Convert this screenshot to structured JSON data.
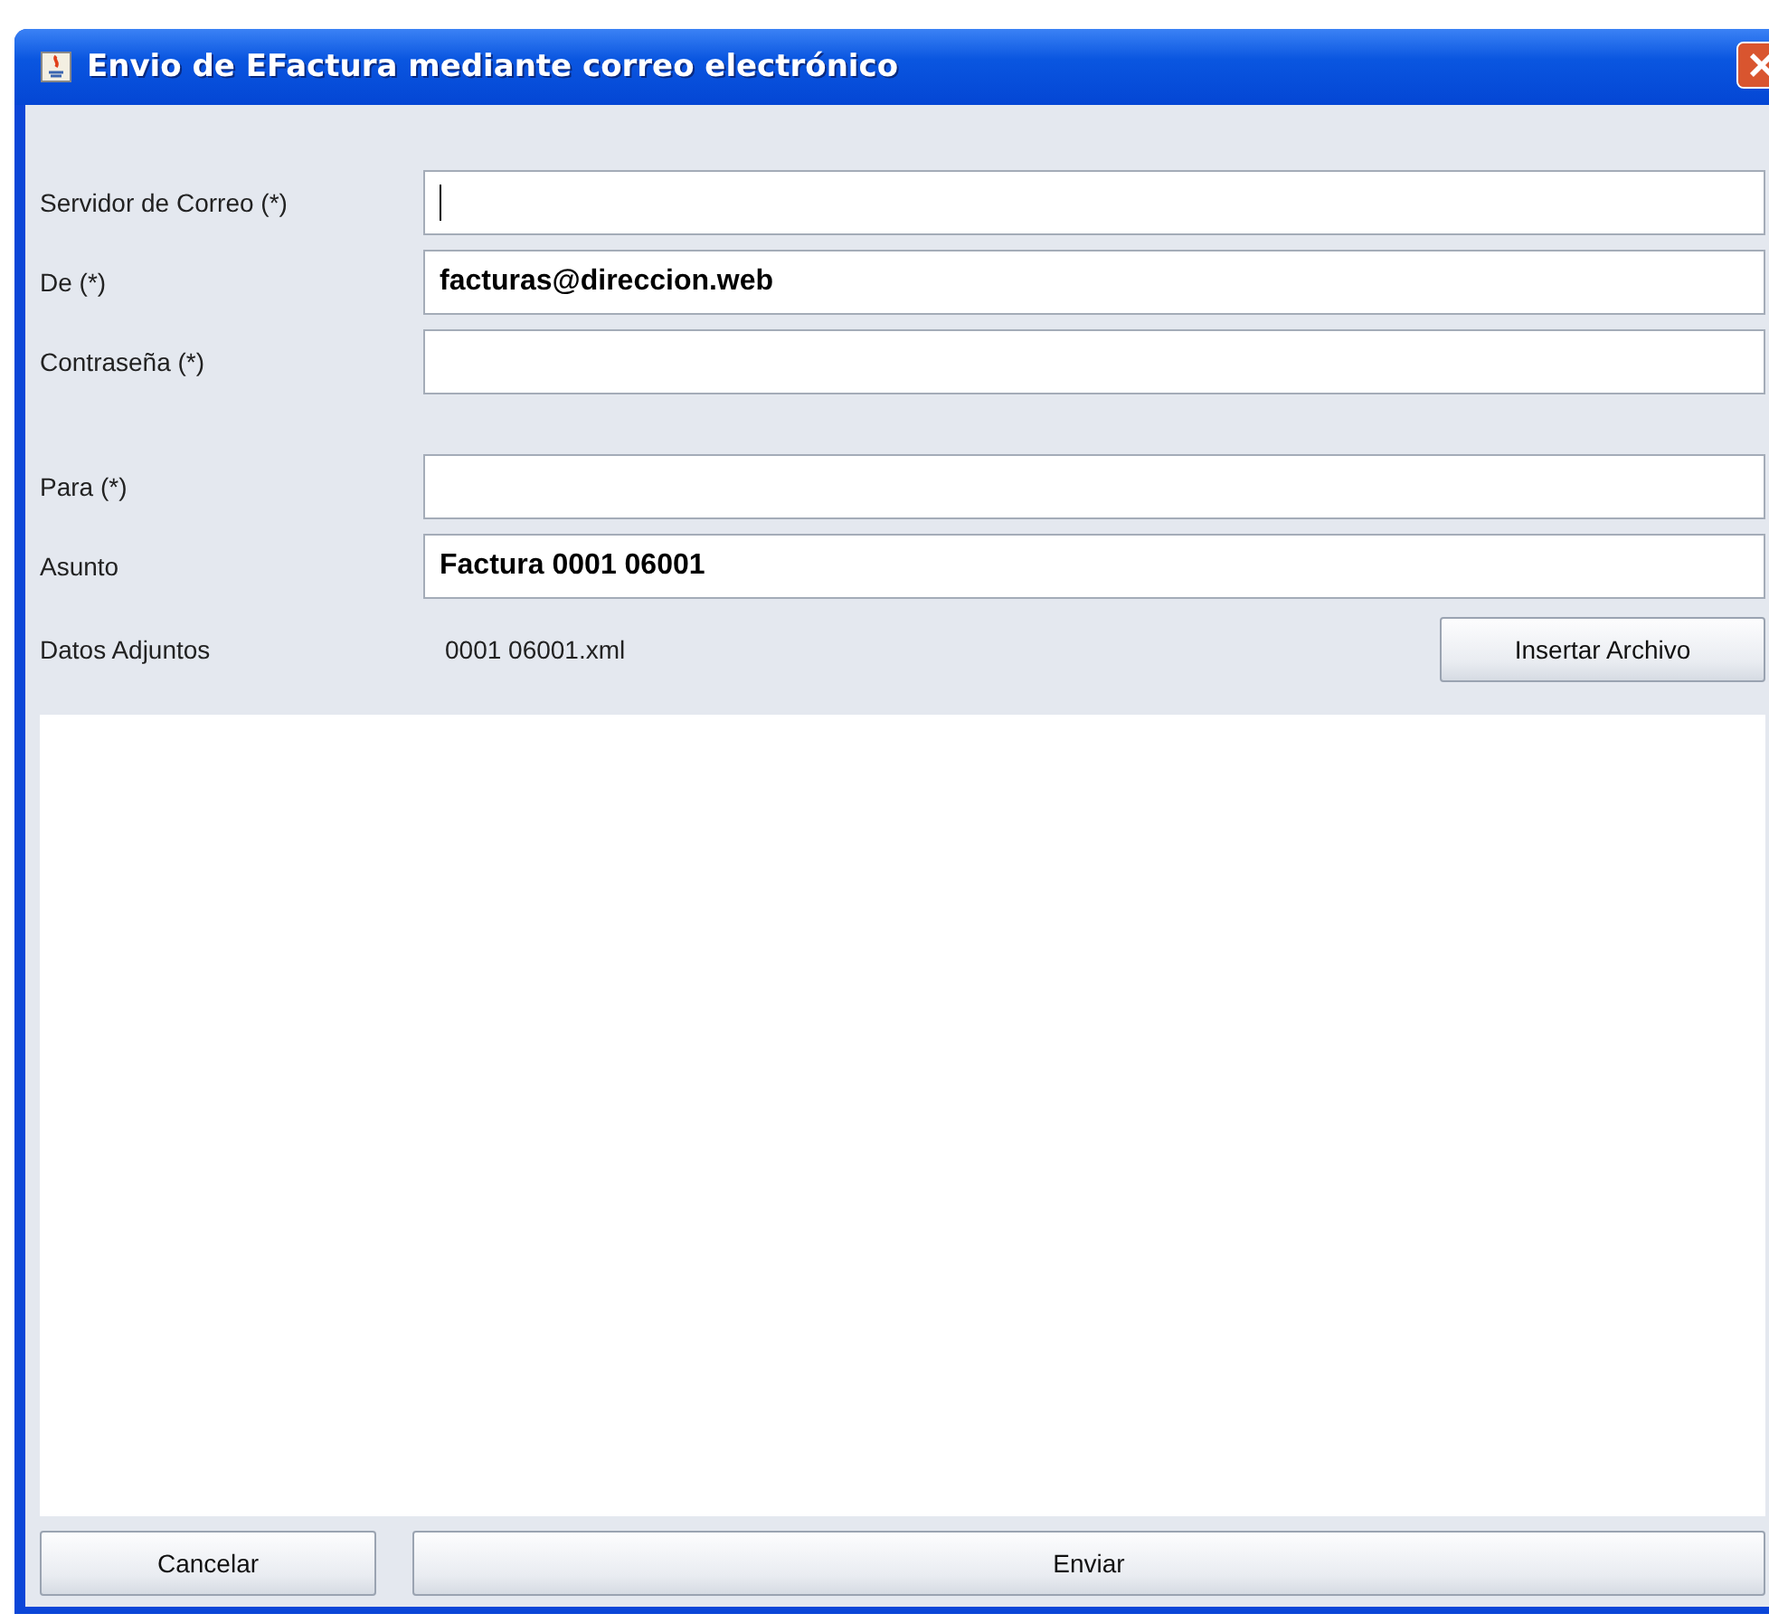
{
  "window": {
    "title": "Envio de EFactura mediante correo electrónico"
  },
  "account_fields": [
    {
      "label": "Servidor de Correo (*)",
      "focused": true
    },
    {
      "label": "De (*)",
      "value": "facturas@direccion.web",
      "focused": false
    },
    {
      "label": "Contraseña (*)",
      "focused": false
    }
  ],
  "message_fields": [
    {
      "label": "Para (*)",
      "focused": false
    },
    {
      "label": "Asunto",
      "value": "Factura 0001 06001",
      "focused": false
    }
  ],
  "attachments": {
    "label": "Datos Adjuntos",
    "file": "0001 06001.xml",
    "button": "Insertar Archivo"
  },
  "buttons": [
    {
      "label": "Cancelar",
      "kind": "narrow"
    },
    {
      "label": "Enviar",
      "kind": "wide"
    }
  ]
}
